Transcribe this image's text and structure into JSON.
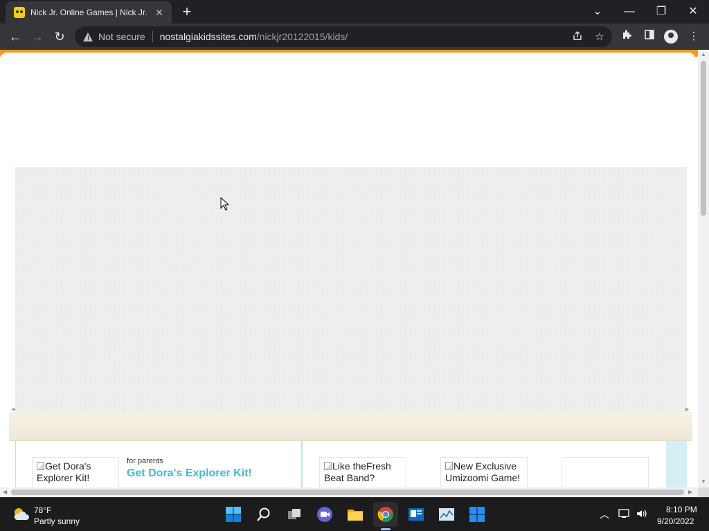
{
  "browser": {
    "tab": {
      "title": "Nick Jr. Online Games | Nick Jr. V",
      "close": "✕",
      "favicon": "nick-jr-favicon-icon"
    },
    "new_tab": "+",
    "window_controls": {
      "dropdown": "⌄",
      "minimize": "—",
      "restore": "❐",
      "close": "✕"
    },
    "nav": {
      "back": "←",
      "forward": "→",
      "reload": "↻"
    },
    "omnibox": {
      "security_label": "Not secure",
      "url_host": "nostalgiakidssites.com",
      "url_path": "/nickjr20122015/kids/"
    },
    "toolbar_icons": [
      "share-icon",
      "bookmark-star-icon",
      "extensions-icon",
      "side-panel-icon",
      "profile-icon",
      "menu-icon"
    ]
  },
  "page": {
    "promo_left": {
      "image_alt": "Get Dora's Explorer Kit!",
      "kicker": "for parents",
      "headline": "Get Dora's Explorer Kit!"
    },
    "promo_right": [
      {
        "image_alt": "Like theFresh Beat Band?"
      },
      {
        "image_alt": "New Exclusive Umizoomi Game!"
      },
      {
        "image_alt": ""
      }
    ]
  },
  "taskbar": {
    "weather": {
      "temp": "78°F",
      "desc": "Partly sunny"
    },
    "apps": [
      "start-icon",
      "search-icon",
      "task-view-icon",
      "chat-icon",
      "file-explorer-icon",
      "chrome-icon",
      "news-icon",
      "stocks-icon",
      "store-icon"
    ],
    "active_app": "chrome-icon",
    "clock": {
      "time": "8:10 PM",
      "date": "9/20/2022"
    }
  }
}
